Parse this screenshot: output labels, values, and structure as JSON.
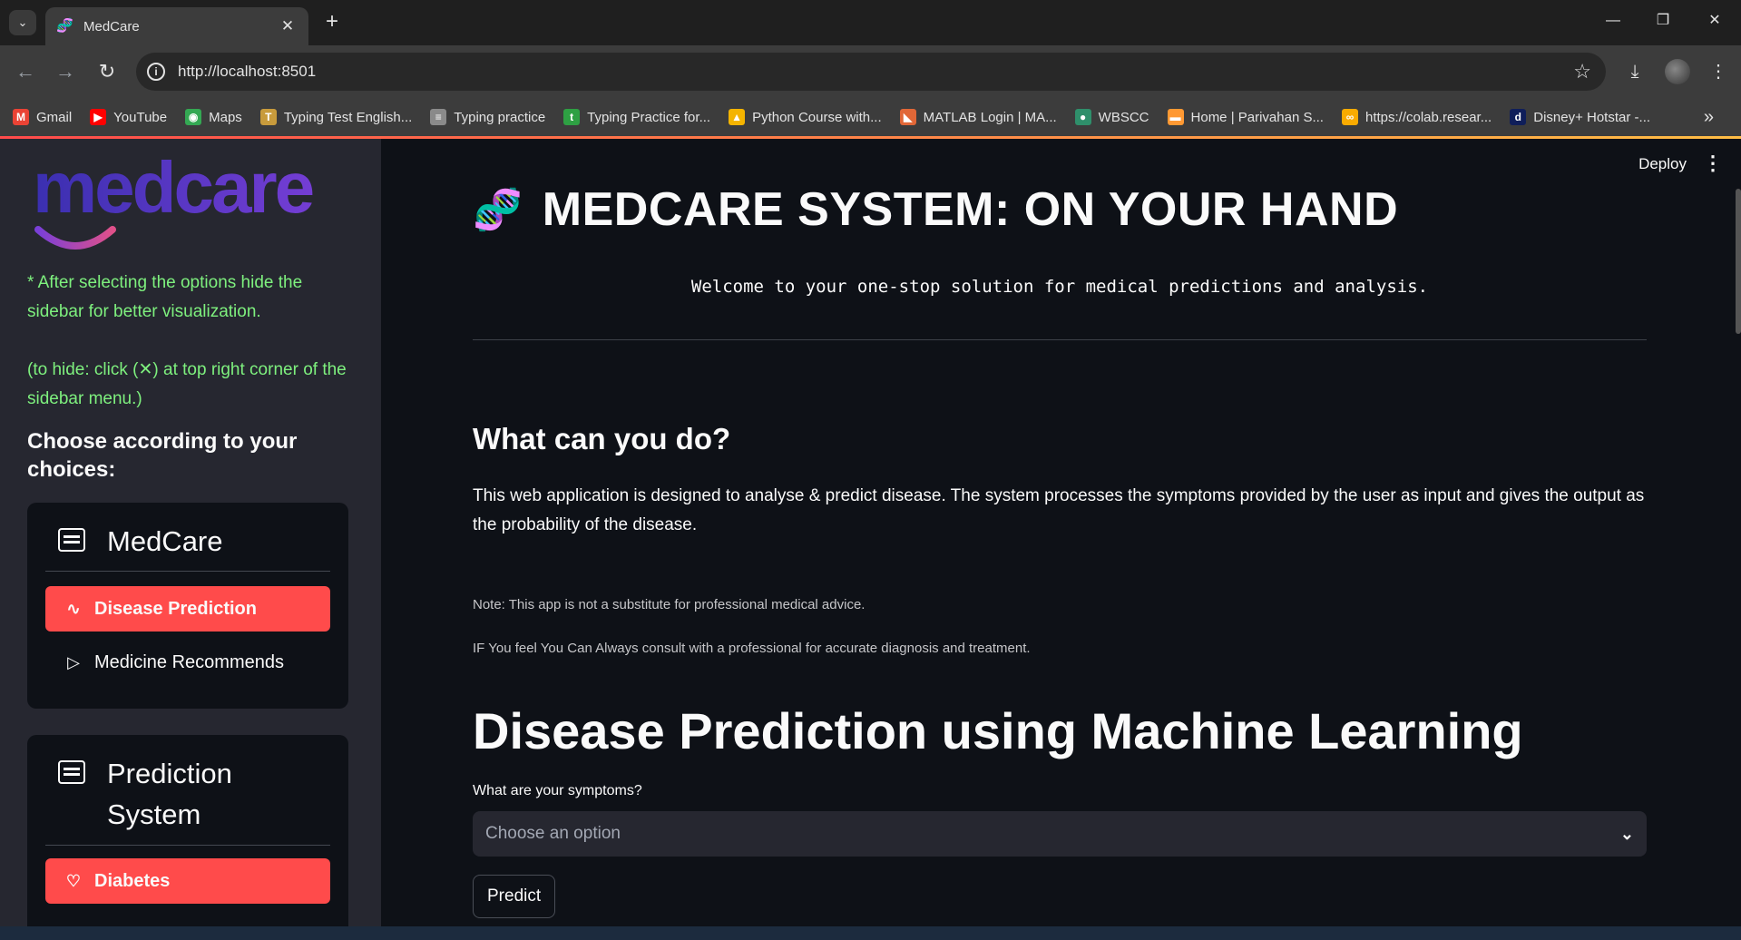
{
  "browser": {
    "tab_title": "MedCare",
    "url": "http://localhost:8501",
    "bookmarks": [
      {
        "label": "Gmail",
        "color": "#ea4335",
        "glyph": "M"
      },
      {
        "label": "YouTube",
        "color": "#ff0000",
        "glyph": "▶"
      },
      {
        "label": "Maps",
        "color": "#34a853",
        "glyph": "◉"
      },
      {
        "label": "Typing Test English...",
        "color": "#c89b3c",
        "glyph": "T"
      },
      {
        "label": "Typing practice",
        "color": "#8a8a8a",
        "glyph": "≡"
      },
      {
        "label": "Typing Practice for...",
        "color": "#2ea043",
        "glyph": "t"
      },
      {
        "label": "Python Course with...",
        "color": "#f4b400",
        "glyph": "▲"
      },
      {
        "label": "MATLAB Login | MA...",
        "color": "#e16737",
        "glyph": "◣"
      },
      {
        "label": "WBSCC",
        "color": "#2f8f6b",
        "glyph": "●"
      },
      {
        "label": "Home | Parivahan S...",
        "color": "#ff9933",
        "glyph": "▬"
      },
      {
        "label": "https://colab.resear...",
        "color": "#f9ab00",
        "glyph": "∞"
      },
      {
        "label": "Disney+ Hotstar -...",
        "color": "#0f1e5a",
        "glyph": "d"
      }
    ]
  },
  "sidebar": {
    "logo": "medcare",
    "hint1": "* After selecting the options hide the sidebar for better visualization.",
    "hint2": "(to hide: click (✕) at top right corner of the sidebar menu.)",
    "choose": "Choose according to your choices:",
    "menu1": {
      "title": "MedCare",
      "items": [
        {
          "label": "Disease Prediction",
          "icon": "activity-icon",
          "active": true
        },
        {
          "label": "Medicine Recommends",
          "icon": "play-outline-icon",
          "active": false
        }
      ]
    },
    "menu2": {
      "title": "Prediction System",
      "items": [
        {
          "label": "Diabetes",
          "icon": "heart-icon",
          "active": true
        }
      ]
    }
  },
  "main": {
    "deploy": "Deploy",
    "title": "MEDCARE SYSTEM: ON YOUR HAND",
    "welcome": "Welcome to your one-stop solution for medical predictions and analysis.",
    "what_heading": "What can you do?",
    "what_text": "This web application is designed to analyse & predict disease. The system processes the symptoms provided by the user as input and gives the output as the probability of the disease.",
    "note1": "Note: This app is not a substitute for professional medical advice.",
    "note2": "IF You feel You Can Always consult with a professional for accurate diagnosis and treatment.",
    "section_title": "Disease Prediction using Machine Learning",
    "symptoms_label": "What are your symptoms?",
    "symptoms_placeholder": "Choose an option",
    "predict_button": "Predict"
  },
  "colors": {
    "accent": "#ff4b4b",
    "hint_green": "#7ef07e",
    "bg": "#0e1117",
    "sidebar_bg": "#262730"
  }
}
